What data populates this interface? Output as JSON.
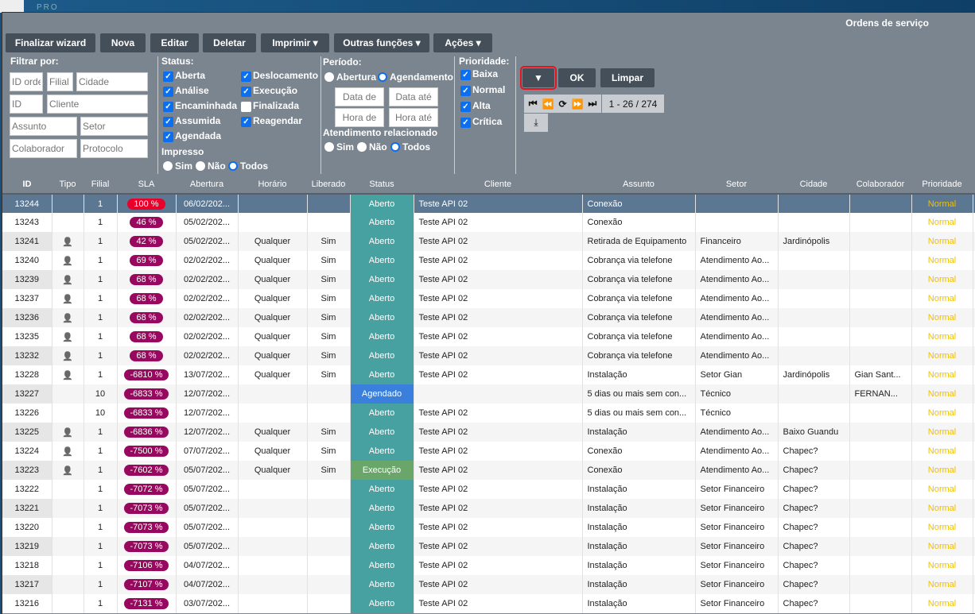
{
  "window": {
    "title": "Ordens de serviço",
    "logo": "PRO"
  },
  "toolbar": {
    "finalizar": "Finalizar wizard",
    "nova": "Nova",
    "editar": "Editar",
    "deletar": "Deletar",
    "imprimir": "Imprimir ▾",
    "outras": "Outras funções ▾",
    "acoes": "Ações ▾"
  },
  "filter": {
    "label": "Filtrar por:",
    "id_order": "ID order",
    "filial": "Filial",
    "cidade": "Cidade",
    "id": "ID",
    "cliente": "Cliente",
    "assunto": "Assunto",
    "setor": "Setor",
    "colaborador": "Colaborador",
    "protocolo": "Protocolo"
  },
  "status": {
    "label": "Status:",
    "items": [
      {
        "label": "Aberta",
        "checked": true
      },
      {
        "label": "Análise",
        "checked": true
      },
      {
        "label": "Encaminhada",
        "checked": true
      },
      {
        "label": "Assumida",
        "checked": true
      },
      {
        "label": "Agendada",
        "checked": true
      },
      {
        "label": "Deslocamento",
        "checked": true
      },
      {
        "label": "Execução",
        "checked": true
      },
      {
        "label": "Finalizada",
        "checked": false
      },
      {
        "label": "Reagendar",
        "checked": true
      }
    ],
    "impresso": "Impresso",
    "impresso_opts": [
      "Sim",
      "Não",
      "Todos"
    ],
    "impresso_selected": "Todos"
  },
  "periodo": {
    "label": "Período:",
    "opts": [
      "Abertura",
      "Agendamento"
    ],
    "selected": "Agendamento",
    "data_de": "Data de",
    "data_ate": "Data até",
    "hora_de": "Hora de",
    "hora_ate": "Hora até",
    "atend_label": "Atendimento relacionado",
    "atend_opts": [
      "Sim",
      "Não",
      "Todos"
    ],
    "atend_selected": "Todos"
  },
  "prioridade": {
    "label": "Prioridade:",
    "items": [
      {
        "label": "Baixa",
        "checked": true
      },
      {
        "label": "Normal",
        "checked": true
      },
      {
        "label": "Alta",
        "checked": true
      },
      {
        "label": "Crítica",
        "checked": true
      }
    ]
  },
  "actions": {
    "filter_icon": "filter-icon",
    "ok": "OK",
    "limpar": "Limpar"
  },
  "pager": {
    "range": "1 - 26 / 274",
    "icons": [
      "first-icon",
      "prev-icon",
      "refresh-icon",
      "next-icon",
      "last-icon",
      "download-icon"
    ]
  },
  "colors": {
    "aberto": "#48a1a1",
    "agendado": "#3b7fdd",
    "execucao": "#6aa56a",
    "sla_red": "#e8002a",
    "sla_purple": "#98085f",
    "prioridade": "#f0c000"
  },
  "table": {
    "columns": [
      "ID",
      "Tipo",
      "Filial",
      "SLA",
      "Abertura",
      "Horário",
      "Liberado",
      "Status",
      "Cliente",
      "Assunto",
      "Setor",
      "Cidade",
      "Colaborador",
      "Prioridade"
    ],
    "rows": [
      [
        "13244",
        "",
        "1",
        "100 %",
        "06/02/202...",
        "",
        "",
        "Aberto",
        "Teste API 02",
        "Conexão",
        "",
        "",
        "",
        "Normal"
      ],
      [
        "13243",
        "",
        "1",
        "46 %",
        "05/02/202...",
        "",
        "",
        "Aberto",
        "Teste API 02",
        "Conexão",
        "",
        "",
        "",
        "Normal"
      ],
      [
        "13241",
        "user",
        "1",
        "42 %",
        "05/02/202...",
        "Qualquer",
        "Sim",
        "Aberto",
        "Teste API 02",
        "Retirada de Equipamento",
        "Financeiro",
        "Jardinópolis",
        "",
        "Normal"
      ],
      [
        "13240",
        "user",
        "1",
        "69 %",
        "02/02/202...",
        "Qualquer",
        "Sim",
        "Aberto",
        "Teste API 02",
        "Cobrança via telefone",
        "Atendimento Ao...",
        "",
        "",
        "Normal"
      ],
      [
        "13239",
        "user",
        "1",
        "68 %",
        "02/02/202...",
        "Qualquer",
        "Sim",
        "Aberto",
        "Teste API 02",
        "Cobrança via telefone",
        "Atendimento Ao...",
        "",
        "",
        "Normal"
      ],
      [
        "13237",
        "user",
        "1",
        "68 %",
        "02/02/202...",
        "Qualquer",
        "Sim",
        "Aberto",
        "Teste API 02",
        "Cobrança via telefone",
        "Atendimento Ao...",
        "",
        "",
        "Normal"
      ],
      [
        "13236",
        "user",
        "1",
        "68 %",
        "02/02/202...",
        "Qualquer",
        "Sim",
        "Aberto",
        "Teste API 02",
        "Cobrança via telefone",
        "Atendimento Ao...",
        "",
        "",
        "Normal"
      ],
      [
        "13235",
        "user",
        "1",
        "68 %",
        "02/02/202...",
        "Qualquer",
        "Sim",
        "Aberto",
        "Teste API 02",
        "Cobrança via telefone",
        "Atendimento Ao...",
        "",
        "",
        "Normal"
      ],
      [
        "13232",
        "user",
        "1",
        "68 %",
        "02/02/202...",
        "Qualquer",
        "Sim",
        "Aberto",
        "Teste API 02",
        "Cobrança via telefone",
        "Atendimento Ao...",
        "",
        "",
        "Normal"
      ],
      [
        "13228",
        "user",
        "1",
        "-6810 %",
        "13/07/202...",
        "Qualquer",
        "Sim",
        "Aberto",
        "Teste API 02",
        "Instalação",
        "Setor Gian",
        "Jardinópolis",
        "Gian Sant...",
        "Normal"
      ],
      [
        "13227",
        "",
        "10",
        "-6833 %",
        "12/07/202...",
        "",
        "",
        "Agendado",
        "",
        "5 dias ou mais sem con...",
        "Técnico",
        "",
        "FERNAN...",
        "Normal"
      ],
      [
        "13226",
        "",
        "10",
        "-6833 %",
        "12/07/202...",
        "",
        "",
        "Aberto",
        "Teste API 02",
        "5 dias ou mais sem con...",
        "Técnico",
        "",
        "",
        "Normal"
      ],
      [
        "13225",
        "user",
        "1",
        "-6836 %",
        "12/07/202...",
        "Qualquer",
        "Sim",
        "Aberto",
        "Teste API 02",
        "Instalação",
        "Atendimento Ao...",
        "Baixo Guandu",
        "",
        "Normal"
      ],
      [
        "13224",
        "user",
        "1",
        "-7500 %",
        "07/07/202...",
        "Qualquer",
        "Sim",
        "Aberto",
        "Teste API 02",
        "Conexão",
        "Atendimento Ao...",
        "Chapec?",
        "",
        "Normal"
      ],
      [
        "13223",
        "user",
        "1",
        "-7602 %",
        "05/07/202...",
        "Qualquer",
        "Sim",
        "Execução",
        "Teste API 02",
        "Conexão",
        "Atendimento Ao...",
        "Chapec?",
        "",
        "Normal"
      ],
      [
        "13222",
        "",
        "1",
        "-7072 %",
        "05/07/202...",
        "",
        "",
        "Aberto",
        "Teste API 02",
        "Instalação",
        "Setor Financeiro",
        "Chapec?",
        "",
        "Normal"
      ],
      [
        "13221",
        "",
        "1",
        "-7073 %",
        "05/07/202...",
        "",
        "",
        "Aberto",
        "Teste API 02",
        "Instalação",
        "Setor Financeiro",
        "Chapec?",
        "",
        "Normal"
      ],
      [
        "13220",
        "",
        "1",
        "-7073 %",
        "05/07/202...",
        "",
        "",
        "Aberto",
        "Teste API 02",
        "Instalação",
        "Setor Financeiro",
        "Chapec?",
        "",
        "Normal"
      ],
      [
        "13219",
        "",
        "1",
        "-7073 %",
        "05/07/202...",
        "",
        "",
        "Aberto",
        "Teste API 02",
        "Instalação",
        "Setor Financeiro",
        "Chapec?",
        "",
        "Normal"
      ],
      [
        "13218",
        "",
        "1",
        "-7106 %",
        "04/07/202...",
        "",
        "",
        "Aberto",
        "Teste API 02",
        "Instalação",
        "Setor Financeiro",
        "Chapec?",
        "",
        "Normal"
      ],
      [
        "13217",
        "",
        "1",
        "-7107 %",
        "04/07/202...",
        "",
        "",
        "Aberto",
        "Teste API 02",
        "Instalação",
        "Setor Financeiro",
        "Chapec?",
        "",
        "Normal"
      ],
      [
        "13216",
        "",
        "1",
        "-7131 %",
        "03/07/202...",
        "",
        "",
        "Aberto",
        "Teste API 02",
        "Instalação",
        "Setor Financeiro",
        "Chapec?",
        "",
        "Normal"
      ]
    ],
    "selected_row": "13244",
    "sorted_column": "ID"
  }
}
